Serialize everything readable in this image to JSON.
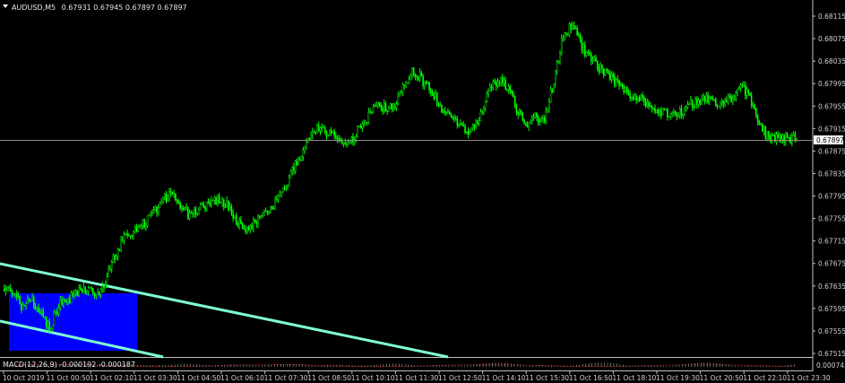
{
  "header": {
    "symbol": "AUDUSD,M5",
    "ohlc": "0.67931 0.67945 0.67897 0.67897",
    "dropdown_icon": "triangle-down-icon"
  },
  "macd": {
    "label": "MACD(12,26,9) -0.000192 -0.000187",
    "scale_label": "0.000743"
  },
  "current_price": "0.67897",
  "colors": {
    "background": "#000000",
    "candle": "#00ff00",
    "channel": "#7fffd4",
    "rectangle": "#0000ff",
    "grid": "#808080",
    "macd_hist": "#b0b0b0",
    "macd_signal": "#ff3030"
  },
  "chart_data": {
    "type": "candlestick",
    "symbol": "AUDUSD",
    "timeframe": "M5",
    "y_ticks": [
      "0.68115",
      "0.68075",
      "0.68035",
      "0.67995",
      "0.67955",
      "0.67915",
      "0.67875",
      "0.67835",
      "0.67795",
      "0.67755",
      "0.67715",
      "0.67675",
      "0.67635",
      "0.67595",
      "0.67555",
      "0.67515"
    ],
    "ylim": [
      0.67507,
      0.6814
    ],
    "x_ticks": [
      "10 Oct 2019",
      "11 Oct 00:50",
      "11 Oct 02:10",
      "11 Oct 03:30",
      "11 Oct 04:50",
      "11 Oct 06:10",
      "11 Oct 07:30",
      "11 Oct 08:50",
      "11 Oct 10:10",
      "11 Oct 11:30",
      "11 Oct 12:50",
      "11 Oct 14:10",
      "11 Oct 15:30",
      "11 Oct 16:50",
      "11 Oct 18:10",
      "11 Oct 19:30",
      "11 Oct 20:50",
      "11 Oct 22:10",
      "11 Oct 23:30"
    ],
    "close_path": [
      [
        0,
        0.6763
      ],
      [
        6,
        0.67625
      ],
      [
        12,
        0.676
      ],
      [
        18,
        0.6761
      ],
      [
        24,
        0.6759
      ],
      [
        30,
        0.6756
      ],
      [
        36,
        0.676
      ],
      [
        42,
        0.6761
      ],
      [
        48,
        0.67625
      ],
      [
        54,
        0.6763
      ],
      [
        60,
        0.67615
      ],
      [
        66,
        0.6764
      ],
      [
        72,
        0.6769
      ],
      [
        78,
        0.6772
      ],
      [
        84,
        0.67735
      ],
      [
        90,
        0.67745
      ],
      [
        96,
        0.6776
      ],
      [
        102,
        0.67785
      ],
      [
        108,
        0.678
      ],
      [
        114,
        0.6778
      ],
      [
        120,
        0.6776
      ],
      [
        126,
        0.6777
      ],
      [
        132,
        0.6778
      ],
      [
        138,
        0.6779
      ],
      [
        144,
        0.6778
      ],
      [
        150,
        0.67755
      ],
      [
        156,
        0.6773
      ],
      [
        162,
        0.6775
      ],
      [
        168,
        0.6777
      ],
      [
        174,
        0.6778
      ],
      [
        180,
        0.678
      ],
      [
        186,
        0.6784
      ],
      [
        192,
        0.6787
      ],
      [
        198,
        0.679
      ],
      [
        204,
        0.6792
      ],
      [
        210,
        0.67905
      ],
      [
        216,
        0.679
      ],
      [
        222,
        0.6789
      ],
      [
        228,
        0.6791
      ],
      [
        234,
        0.6793
      ],
      [
        240,
        0.6796
      ],
      [
        246,
        0.6795
      ],
      [
        252,
        0.6796
      ],
      [
        258,
        0.6799
      ],
      [
        264,
        0.6802
      ],
      [
        270,
        0.68
      ],
      [
        276,
        0.6798
      ],
      [
        282,
        0.6795
      ],
      [
        288,
        0.67935
      ],
      [
        294,
        0.6792
      ],
      [
        300,
        0.67905
      ],
      [
        306,
        0.67935
      ],
      [
        312,
        0.6798
      ],
      [
        318,
        0.68
      ],
      [
        324,
        0.6799
      ],
      [
        330,
        0.6795
      ],
      [
        336,
        0.67925
      ],
      [
        342,
        0.67935
      ],
      [
        348,
        0.6793
      ],
      [
        354,
        0.68
      ],
      [
        360,
        0.6808
      ],
      [
        366,
        0.681
      ],
      [
        372,
        0.6806
      ],
      [
        378,
        0.6804
      ],
      [
        384,
        0.6802
      ],
      [
        390,
        0.6801
      ],
      [
        396,
        0.6799
      ],
      [
        402,
        0.6798
      ],
      [
        408,
        0.6797
      ],
      [
        414,
        0.6796
      ],
      [
        420,
        0.6795
      ],
      [
        426,
        0.67945
      ],
      [
        432,
        0.67935
      ],
      [
        438,
        0.6795
      ],
      [
        444,
        0.6796
      ],
      [
        450,
        0.6797
      ],
      [
        456,
        0.67965
      ],
      [
        462,
        0.6796
      ],
      [
        468,
        0.6797
      ],
      [
        474,
        0.6799
      ],
      [
        480,
        0.6797
      ],
      [
        486,
        0.6792
      ],
      [
        492,
        0.679
      ],
      [
        498,
        0.679
      ],
      [
        504,
        0.67895
      ],
      [
        510,
        0.67897
      ]
    ],
    "candle_count": 510,
    "macd": {
      "name": "MACD(12,26,9)",
      "main": -0.000192,
      "signal": -0.000187
    }
  }
}
